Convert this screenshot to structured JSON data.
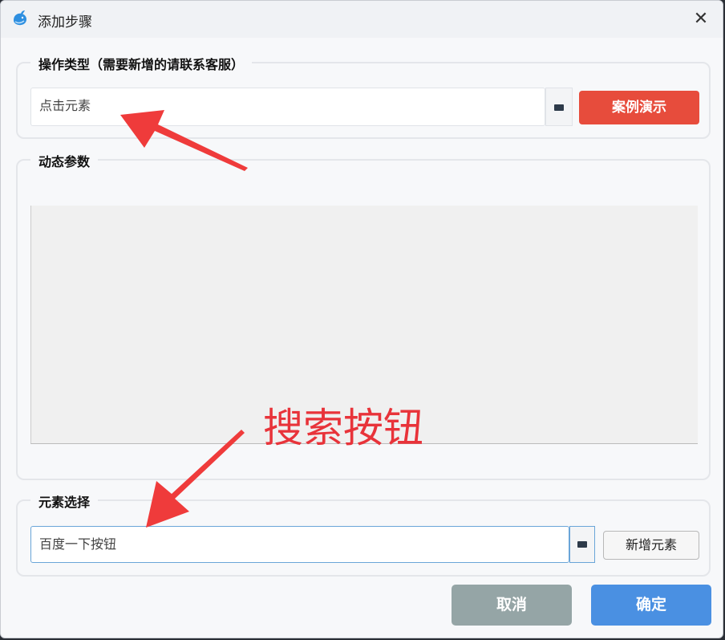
{
  "window": {
    "title": "添加步骤",
    "close_glyph": "✕"
  },
  "operation_type": {
    "legend": "操作类型（需要新增的请联系客服）",
    "value": "点击元素",
    "demo_button": "案例演示"
  },
  "dynamic_params": {
    "legend": "动态参数"
  },
  "element_select": {
    "legend": "元素选择",
    "value": "百度一下按钮",
    "add_button": "新增元素"
  },
  "footer": {
    "cancel": "取消",
    "confirm": "确定"
  },
  "annotation": {
    "text": "搜索按钮",
    "color": "#e8333a"
  },
  "colors": {
    "demo": "#e74c3c",
    "cancel": "#95a5a6",
    "confirm": "#4a90e2"
  },
  "icons": [
    "app-logo-icon",
    "close-icon",
    "dropdown-icon"
  ]
}
